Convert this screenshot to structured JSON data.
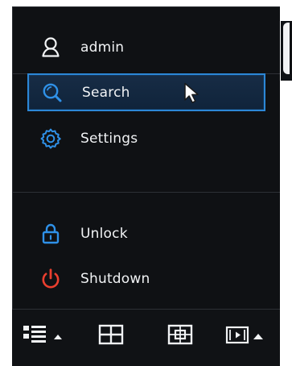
{
  "menu": {
    "user": {
      "label": "admin",
      "icon": "user-icon"
    },
    "items": [
      {
        "label": "Search",
        "icon": "search-icon",
        "selected": true,
        "icon_color": "#2f91e8"
      },
      {
        "label": "Settings",
        "icon": "gear-icon",
        "selected": false,
        "icon_color": "#2f91e8"
      },
      {
        "label": "Unlock",
        "icon": "lock-icon",
        "selected": false,
        "icon_color": "#2f91e8"
      },
      {
        "label": "Shutdown",
        "icon": "power-icon",
        "selected": false,
        "icon_color": "#ea3f2f"
      }
    ]
  },
  "toolbar": {
    "items": [
      {
        "icon": "layout-list-icon",
        "menu_arrow": "chevron-up-icon"
      },
      {
        "icon": "quad-grid-icon"
      },
      {
        "icon": "camera-view-icon"
      },
      {
        "icon": "playback-icon",
        "menu_arrow": "chevron-up-icon"
      }
    ]
  },
  "colors": {
    "panel_background": "#0f1114",
    "text": "#f1f3f5",
    "accent": "#2c87d6",
    "selected_background": "#15283f",
    "danger": "#ea3f2f"
  }
}
